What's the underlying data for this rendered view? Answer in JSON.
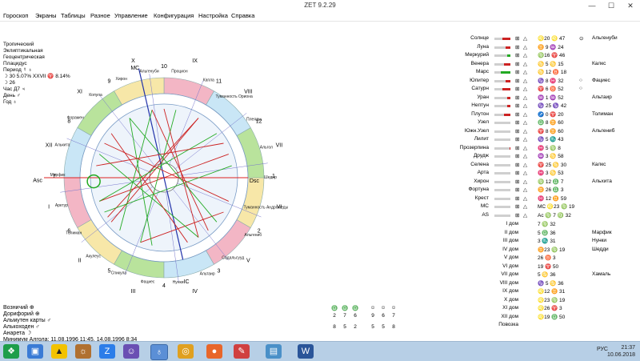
{
  "window": {
    "title": "ZET 9.2.29",
    "minimize": "—",
    "maximize": "☐",
    "close": "✕"
  },
  "menu": [
    "Гороскоп",
    "Экраны",
    "Таблицы",
    "Разное",
    "Управление",
    "Конфигурация",
    "Настройка",
    "Справка"
  ],
  "info_lines": [
    "Тропический",
    "Эклиптикальная",
    "Геоцентрическая",
    "Плацидус",
    "Период ☿ ♁",
    "☽ 30 5.07% XXVII ♈ 8.14%",
    "☽ 26",
    "Час Д7 ♃",
    "День ♂",
    "Год ♁"
  ],
  "chart": {
    "outer_house_numbers": [
      "9",
      "10",
      "11",
      "12",
      "1",
      "2",
      "3",
      "4",
      "5",
      "6",
      "7",
      "8"
    ],
    "roman_houses": [
      "IX",
      "VIII",
      "VII",
      "VI",
      "V",
      "IV",
      "III",
      "II",
      "I",
      "XII",
      "XI",
      "X"
    ],
    "axis_labels": {
      "mc": "MC",
      "ic": "IC",
      "asc": "Asc",
      "dsc": "Dsc"
    },
    "outer_labels": [
      "Альгенуби",
      "Процион",
      "Капла",
      "Туманность Ориона",
      "Плеяды",
      "Альгол",
      "Шедир",
      "Туманность Андромеды",
      "Альгениб",
      "Садальсууд",
      "Альтаир",
      "Нунки",
      "Фациес",
      "Спикула",
      "Акулеус",
      "Толиман",
      "Арктур",
      "Мирфик",
      "Алькита",
      "Форамен",
      "Копула",
      "Хирон"
    ]
  },
  "planets_table": [
    {
      "name": "Солнце",
      "pos": "♌20 ♌ 47",
      "extra": "⊙",
      "star": "Альгенуби",
      "bar": 0.5,
      "bar_color": "#cc2222"
    },
    {
      "name": "Луна",
      "pos": "♊ 9 ♒ 24",
      "extra": "",
      "star": "",
      "bar": 0.3,
      "bar_color": "#cc2222"
    },
    {
      "name": "Меркурий",
      "pos": "♍16 ♈ 46",
      "extra": "",
      "star": "",
      "bar": 0.2,
      "bar_color": "#22aa22"
    },
    {
      "name": "Венера",
      "pos": "♋ 5 ♋ 15",
      "extra": "",
      "star": "Калкс",
      "bar": 0.4,
      "bar_color": "#cc2222"
    },
    {
      "name": "Марс",
      "pos": "♋ 12 ♉ 18",
      "extra": "",
      "star": "",
      "bar": 0.6,
      "bar_color": "#22aa22"
    },
    {
      "name": "Юпитер",
      "pos": "♑ 8 ♓ 32",
      "extra": "○",
      "star": "Фациес",
      "bar": 0.3,
      "bar_color": "#cc2222"
    },
    {
      "name": "Сатурн",
      "pos": "♈ 6 ♉ 52",
      "extra": "○",
      "star": "",
      "bar": 0.5,
      "bar_color": "#cc2222"
    },
    {
      "name": "Уран",
      "pos": "♒ 1 ♒ 52",
      "extra": "",
      "star": "Альтаир",
      "bar": 0.2,
      "bar_color": "#cc2222"
    },
    {
      "name": "Нептун",
      "pos": "♑ 25 ♑ 42",
      "extra": "",
      "star": "",
      "bar": 0.2,
      "bar_color": "#cc2222"
    },
    {
      "name": "Плутон",
      "pos": "♐ 0 ♈ 20",
      "extra": "",
      "star": "Толиман",
      "bar": 0.4,
      "bar_color": "#cc2222"
    },
    {
      "name": "Узел",
      "pos": "♎ 8 ♊ 60",
      "extra": "",
      "star": "",
      "bar": 0,
      "bar_color": "#cccccc"
    },
    {
      "name": "Южн.Узел",
      "pos": "♈ 8 ♊ 60",
      "extra": "",
      "star": "Альгениб",
      "bar": 0,
      "bar_color": "#cccccc"
    },
    {
      "name": "Лилит",
      "pos": "♑ 5 ♏ 43",
      "extra": "",
      "star": "",
      "bar": 0,
      "bar_color": "#cccccc"
    },
    {
      "name": "Прозерпина",
      "pos": "♓ 5 ♍ 8",
      "extra": "",
      "star": "",
      "bar": 0.05,
      "bar_color": "#cc2222"
    },
    {
      "name": "Друдж",
      "pos": "♒ 3 ♋ 58",
      "extra": "",
      "star": "",
      "bar": 0,
      "bar_color": "#cccccc"
    },
    {
      "name": "Селена",
      "pos": "♈ 25 ♋ 30",
      "extra": "",
      "star": "Калкс",
      "bar": 0,
      "bar_color": "#cccccc"
    },
    {
      "name": "Арта",
      "pos": "♓ 3 ♋ 53",
      "extra": "",
      "star": "",
      "bar": 0,
      "bar_color": "#cccccc"
    },
    {
      "name": "Хирон",
      "pos": "♍ 12 ♎ 7",
      "extra": "",
      "star": "Альхита",
      "bar": 0,
      "bar_color": "#cccccc"
    },
    {
      "name": "Фортуна",
      "pos": "♊ 26 ♎ 3",
      "extra": "",
      "star": "",
      "bar": 0,
      "bar_color": "#cccccc"
    },
    {
      "name": "Крест",
      "pos": "♓ 12 ♊ 59",
      "extra": "",
      "star": "",
      "bar": 0,
      "bar_color": "#cccccc"
    },
    {
      "name": "MC",
      "pos": "MC ♌23 ♍ 19",
      "extra": "",
      "star": "",
      "bar": 0,
      "bar_color": "#cccccc"
    },
    {
      "name": "AS",
      "pos": "Ac ♍ 7 ♍ 32",
      "extra": "",
      "star": "",
      "bar": 0,
      "bar_color": "#cccccc"
    }
  ],
  "houses_table": [
    {
      "name": "I дом",
      "pos": "7 ♍ 32",
      "star": ""
    },
    {
      "name": "II дом",
      "pos": "5 ♎ 36",
      "star": "Марфик"
    },
    {
      "name": "III дом",
      "pos": "3 ♏ 31",
      "star": "Нунки"
    },
    {
      "name": "IV дом",
      "pos": "♊23 ♍ 19",
      "star": "Шедди"
    },
    {
      "name": "V дом",
      "pos": "26 ♉ 3",
      "star": ""
    },
    {
      "name": "VI дом",
      "pos": "19 ♈ 50",
      "star": ""
    },
    {
      "name": "VII дом",
      "pos": "5 ♋ 36",
      "star": "Хамаль"
    },
    {
      "name": "VIII дом",
      "pos": "♑ 5 ♋ 36",
      "star": ""
    },
    {
      "name": "IX дом",
      "pos": "♌12 ♊ 31",
      "star": ""
    },
    {
      "name": "X дом",
      "pos": "♌23 ♍ 19",
      "star": ""
    },
    {
      "name": "XI дом",
      "pos": "♌26 ♈ 3",
      "star": ""
    },
    {
      "name": "XII дом",
      "pos": "♌19 ♎ 50",
      "star": ""
    },
    {
      "name": "Повозка",
      "pos": "",
      "star": ""
    }
  ],
  "bottom_info": [
    "Возничий ⊕",
    "Дорифорий ⊕",
    "Альмутен карты ♂",
    "Алькоходен ♂",
    "Анарета ☽",
    "Минимум Алгола: 11.08.1996 11:45, 14.08.1996 8:34"
  ],
  "symgrid": {
    "icons": [
      "♎",
      "♎",
      "♎",
      "☺",
      "☺",
      "☺"
    ],
    "numbers_top": [
      "2",
      "7",
      "6",
      "9",
      "6",
      "7"
    ],
    "numbers_bottom": [
      "8",
      "5",
      "2",
      "5",
      "5",
      "8"
    ]
  },
  "taskbar": {
    "tray": "РУС",
    "time": "21:37",
    "date": "10.06.2018"
  }
}
